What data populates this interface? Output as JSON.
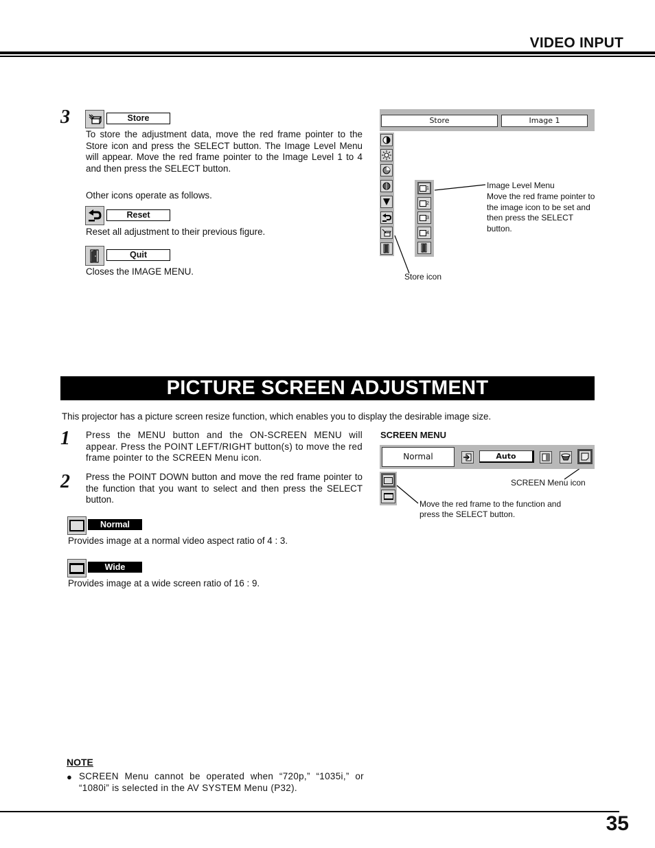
{
  "header": {
    "section_title": "VIDEO INPUT"
  },
  "store_section": {
    "step_number": "3",
    "store": {
      "icon": "store-icon",
      "label": "Store",
      "description": "To store the adjustment data, move the red frame pointer to the Store icon and press the SELECT button.  The Image Level Menu will appear.  Move the red frame pointer to the Image Level 1 to 4 and then press the SELECT button."
    },
    "other_icons_text": "Other icons operate as follows.",
    "reset": {
      "icon": "reset-icon",
      "label": "Reset",
      "description": "Reset all adjustment to their previous figure."
    },
    "quit": {
      "icon": "quit-door-icon",
      "label": "Quit",
      "description": "Closes the IMAGE MENU."
    },
    "menu_diagram": {
      "field_left": "Store",
      "field_right": "Image 1",
      "main_icons": [
        "contrast-icon",
        "brightness-icon",
        "color-icon",
        "tint-icon",
        "down-arrow-icon",
        "reset-icon",
        "store-icon",
        "quit-door-icon"
      ],
      "level_icons": [
        {
          "icon": "image-level-icon",
          "number": "1"
        },
        {
          "icon": "image-level-icon",
          "number": "2"
        },
        {
          "icon": "image-level-icon",
          "number": "3"
        },
        {
          "icon": "image-level-icon",
          "number": "4"
        },
        {
          "icon": "quit-door-icon",
          "number": ""
        }
      ],
      "callout_image_level_title": "Image Level Menu",
      "callout_image_level_text": "Move the red frame pointer to the image icon to be set and then press the SELECT button.",
      "callout_store_icon": "Store icon"
    }
  },
  "picture_screen": {
    "banner_title": "PICTURE SCREEN ADJUSTMENT",
    "intro": "This projector has a picture screen resize function, which enables you to display the desirable image size.",
    "steps": [
      {
        "number": "1",
        "text": "Press the MENU button and the ON-SCREEN MENU will appear.  Press the POINT LEFT/RIGHT button(s) to move the red frame pointer to the SCREEN Menu icon."
      },
      {
        "number": "2",
        "text": "Press the POINT DOWN button and move the red frame pointer to the function that you want to select and then press the SELECT button."
      }
    ],
    "modes": [
      {
        "icon": "normal-screen-icon",
        "label": "Normal",
        "description": "Provides image at a normal video aspect ratio of 4 : 3."
      },
      {
        "icon": "wide-screen-icon",
        "label": "Wide",
        "description": "Provides image at a wide screen ratio of 16 : 9."
      }
    ],
    "screen_menu": {
      "heading": "SCREEN MENU",
      "field_left": "Normal",
      "field_mid": "Auto",
      "toolbar_icons": [
        "input-icon",
        "image-adjust-icon",
        "sound-icon",
        "screen-menu-icon"
      ],
      "callout_screen_menu_icon": "SCREEN Menu icon",
      "callout_move": "Move the red frame to the function and press the SELECT button."
    }
  },
  "note": {
    "heading": "NOTE",
    "bullet": "SCREEN Menu cannot be operated when “720p,” “1035i,” or “1080i” is selected in the AV SYSTEM Menu (P32)."
  },
  "footer": {
    "page_number": "35"
  }
}
